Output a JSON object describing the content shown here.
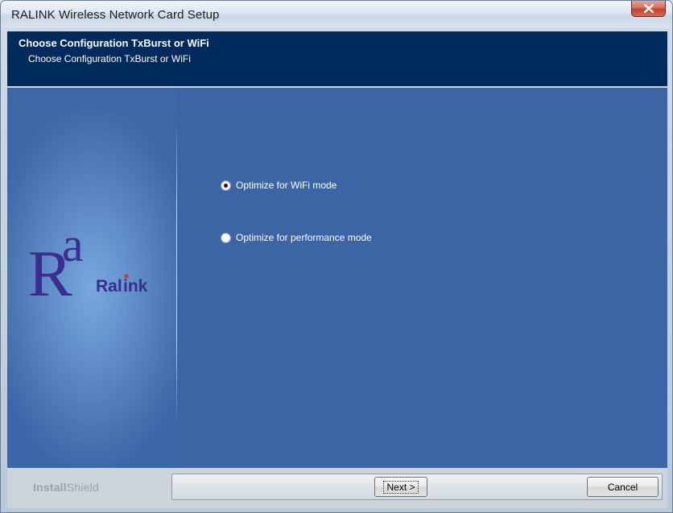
{
  "window": {
    "title": "RALINK Wireless Network Card Setup",
    "close_icon": "close-icon"
  },
  "header": {
    "title": "Choose Configuration TxBurst or WiFi",
    "subtitle": "Choose Configuration TxBurst or WiFi"
  },
  "logo": {
    "brand": "Ralink"
  },
  "options": [
    {
      "label": "Optimize for WiFi mode",
      "checked": true
    },
    {
      "label": "Optimize for performance mode",
      "checked": false
    }
  ],
  "footer": {
    "installshield_bold": "Install",
    "installshield_thin": "Shield",
    "next_label": "Next >",
    "cancel_label": "Cancel"
  },
  "colors": {
    "header_bg": "#002a5c",
    "body_bg": "#3d65a6",
    "logo_purple": "#3a2d8f"
  }
}
